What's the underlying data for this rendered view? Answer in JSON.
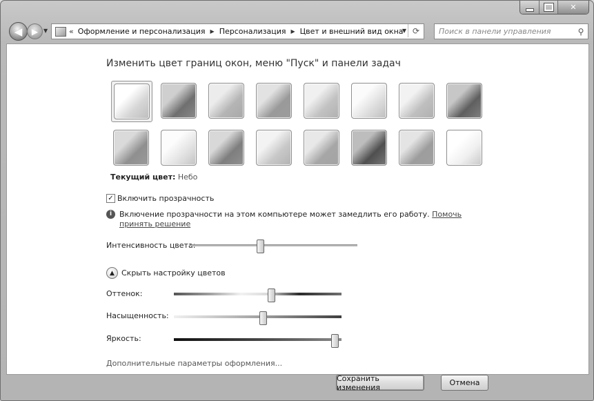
{
  "window": {
    "caption": {
      "minimize": "",
      "maximize": "",
      "close": "✕"
    }
  },
  "nav": {
    "back_glyph": "◀",
    "forward_glyph": "▶",
    "recent_glyph": "▼",
    "address": {
      "prefix": "«",
      "crumbs": [
        "Оформление и персонализация",
        "Персонализация",
        "Цвет и внешний вид окна"
      ],
      "separator": "▶",
      "dropdown": "▼",
      "refresh": "⟳"
    },
    "search": {
      "placeholder": "Поиск в панели управления",
      "icon_glyph": "⚲"
    }
  },
  "content": {
    "heading": "Изменить цвет границ окон, меню \"Пуск\" и панели задач",
    "swatches": [
      {
        "selected": true,
        "top": "#ffffff",
        "bottom": "#d6d6d6",
        "edge": "#bdbdbd"
      },
      {
        "selected": false,
        "top": "#cfcfcf",
        "bottom": "#6f6f6f",
        "edge": "#8a8a8a"
      },
      {
        "selected": false,
        "top": "#ececec",
        "bottom": "#b5b5b5",
        "edge": "#a8a8a8"
      },
      {
        "selected": false,
        "top": "#e2e2e2",
        "bottom": "#9a9a9a",
        "edge": "#9c9c9c"
      },
      {
        "selected": false,
        "top": "#f0f0f0",
        "bottom": "#c2c2c2",
        "edge": "#b0b0b0"
      },
      {
        "selected": false,
        "top": "#fbfbfb",
        "bottom": "#dedede",
        "edge": "#bdbdbd"
      },
      {
        "selected": false,
        "top": "#f2f2f2",
        "bottom": "#bfbfbf",
        "edge": "#b0b0b0"
      },
      {
        "selected": false,
        "top": "#c7c7c7",
        "bottom": "#5f5f5f",
        "edge": "#808080"
      },
      {
        "selected": false,
        "top": "#dadada",
        "bottom": "#8f8f8f",
        "edge": "#9a9a9a"
      },
      {
        "selected": false,
        "top": "#fcfcfc",
        "bottom": "#e4e4e4",
        "edge": "#c3c3c3"
      },
      {
        "selected": false,
        "top": "#d8d8d8",
        "bottom": "#7e7e7e",
        "edge": "#909090"
      },
      {
        "selected": false,
        "top": "#f3f3f3",
        "bottom": "#c8c8c8",
        "edge": "#b3b3b3"
      },
      {
        "selected": false,
        "top": "#e8e8e8",
        "bottom": "#a6a6a6",
        "edge": "#a4a4a4"
      },
      {
        "selected": false,
        "top": "#bdbdbd",
        "bottom": "#4f4f4f",
        "edge": "#777777"
      },
      {
        "selected": false,
        "top": "#e4e4e4",
        "bottom": "#9d9d9d",
        "edge": "#a0a0a0"
      },
      {
        "selected": false,
        "top": "#ffffff",
        "bottom": "#f0f0f0",
        "edge": "#c8c8c8"
      }
    ],
    "current_color_label": "Текущий цвет:",
    "current_color_value": "Небо",
    "transparency_check_glyph": "✓",
    "transparency_label": "Включить прозрачность",
    "info_text": "Включение прозрачности на этом компьютере может замедлить его работу.",
    "info_link": "Помочь принять решение",
    "intensity_label": "Интенсивность цвета:",
    "intensity_value": 0.42,
    "toggle_glyph": "▲",
    "toggle_label": "Скрыть настройку цветов",
    "hue_label": "Оттенок:",
    "hue_value": 0.58,
    "saturation_label": "Насыщенность:",
    "saturation_value": 0.53,
    "brightness_label": "Яркость:",
    "brightness_value": 0.96,
    "advanced_link": "Дополнительные параметры оформления..."
  },
  "buttons": {
    "save": "Сохранить изменения",
    "cancel": "Отмена"
  }
}
